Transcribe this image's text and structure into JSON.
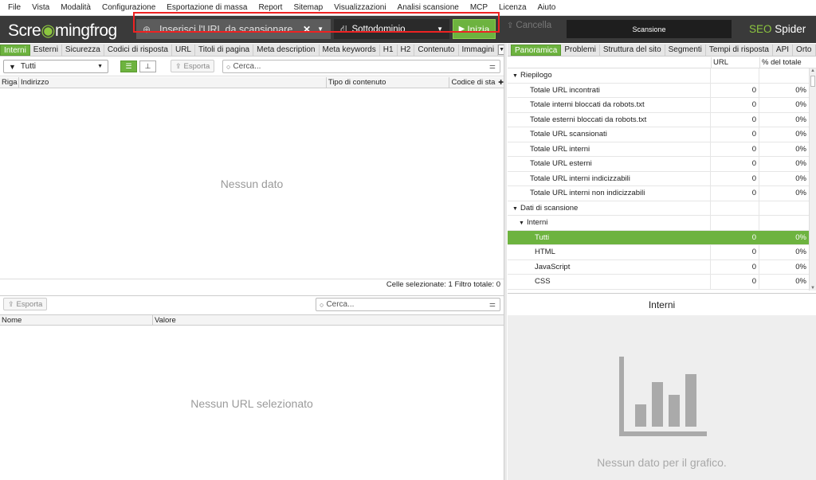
{
  "menu": [
    "File",
    "Vista",
    "Modalità",
    "Configurazione",
    "Esportazione di massa",
    "Report",
    "Sitemap",
    "Visualizzazioni",
    "Analisi scansione",
    "MCP",
    "Licenza",
    "Aiuto"
  ],
  "toolbar": {
    "logo_pre": "Scre",
    "logo_post": "mingfrog",
    "url_placeholder": "Inserisci l'URL da scansionare",
    "mode": "Sottodominio",
    "start": "Inizia",
    "cancel": "Cancella",
    "progress": "Scansione",
    "brand_seo": "SEO",
    "brand_spider": "Spider"
  },
  "left": {
    "tabs": [
      "Interni",
      "Esterni",
      "Sicurezza",
      "Codici di risposta",
      "URL",
      "Titoli di pagina",
      "Meta description",
      "Meta keywords",
      "H1",
      "H2",
      "Contenuto",
      "Immagini"
    ],
    "filter": "Tutti",
    "export": "Esporta",
    "search_placeholder": "Cerca...",
    "columns": [
      "Riga",
      "Indirizzo",
      "Tipo di contenuto",
      "Codice di sta"
    ],
    "empty": "Nessun dato",
    "status": "Celle selezionate:  1  Filtro totale:  0"
  },
  "bottom": {
    "export": "Esporta",
    "search_placeholder": "Cerca...",
    "columns": [
      "Nome",
      "Valore"
    ],
    "empty": "Nessun URL selezionato"
  },
  "right": {
    "tabs": [
      "Panoramica",
      "Problemi",
      "Struttura del sito",
      "Segmenti",
      "Tempi di risposta",
      "API",
      "Orto"
    ],
    "col_url": "URL",
    "col_pct": "% del totale",
    "rows": [
      {
        "label": "Riepilogo",
        "level": 0,
        "tri": "▼",
        "url": "",
        "pct": ""
      },
      {
        "label": "Totale URL incontrati",
        "level": 2,
        "tri": "",
        "url": "0",
        "pct": "0%"
      },
      {
        "label": "Totale interni bloccati da robots.txt",
        "level": 2,
        "tri": "",
        "url": "0",
        "pct": "0%"
      },
      {
        "label": "Totale esterni bloccati da robots.txt",
        "level": 2,
        "tri": "",
        "url": "0",
        "pct": "0%"
      },
      {
        "label": "Totale URL scansionati",
        "level": 2,
        "tri": "",
        "url": "0",
        "pct": "0%"
      },
      {
        "label": "Totale URL interni",
        "level": 2,
        "tri": "",
        "url": "0",
        "pct": "0%"
      },
      {
        "label": "Totale URL esterni",
        "level": 2,
        "tri": "",
        "url": "0",
        "pct": "0%"
      },
      {
        "label": "Totale URL interni indicizzabili",
        "level": 2,
        "tri": "",
        "url": "0",
        "pct": "0%"
      },
      {
        "label": "Totale URL interni non indicizzabili",
        "level": 2,
        "tri": "",
        "url": "0",
        "pct": "0%"
      },
      {
        "label": "Dati di scansione",
        "level": 0,
        "tri": "▼",
        "url": "",
        "pct": ""
      },
      {
        "label": "Interni",
        "level": 1,
        "tri": "▼",
        "url": "",
        "pct": ""
      },
      {
        "label": "Tutti",
        "level": 3,
        "tri": "",
        "url": "0",
        "pct": "0%",
        "selected": true
      },
      {
        "label": "HTML",
        "level": 3,
        "tri": "",
        "url": "0",
        "pct": "0%"
      },
      {
        "label": "JavaScript",
        "level": 3,
        "tri": "",
        "url": "0",
        "pct": "0%"
      },
      {
        "label": "CSS",
        "level": 3,
        "tri": "",
        "url": "0",
        "pct": "0%"
      }
    ],
    "chart_title": "Interni",
    "chart_empty": "Nessun dato per il grafico."
  },
  "colors": {
    "accent": "#6db33f",
    "toolbar": "#3a3a3a",
    "highlight": "#e22222"
  }
}
